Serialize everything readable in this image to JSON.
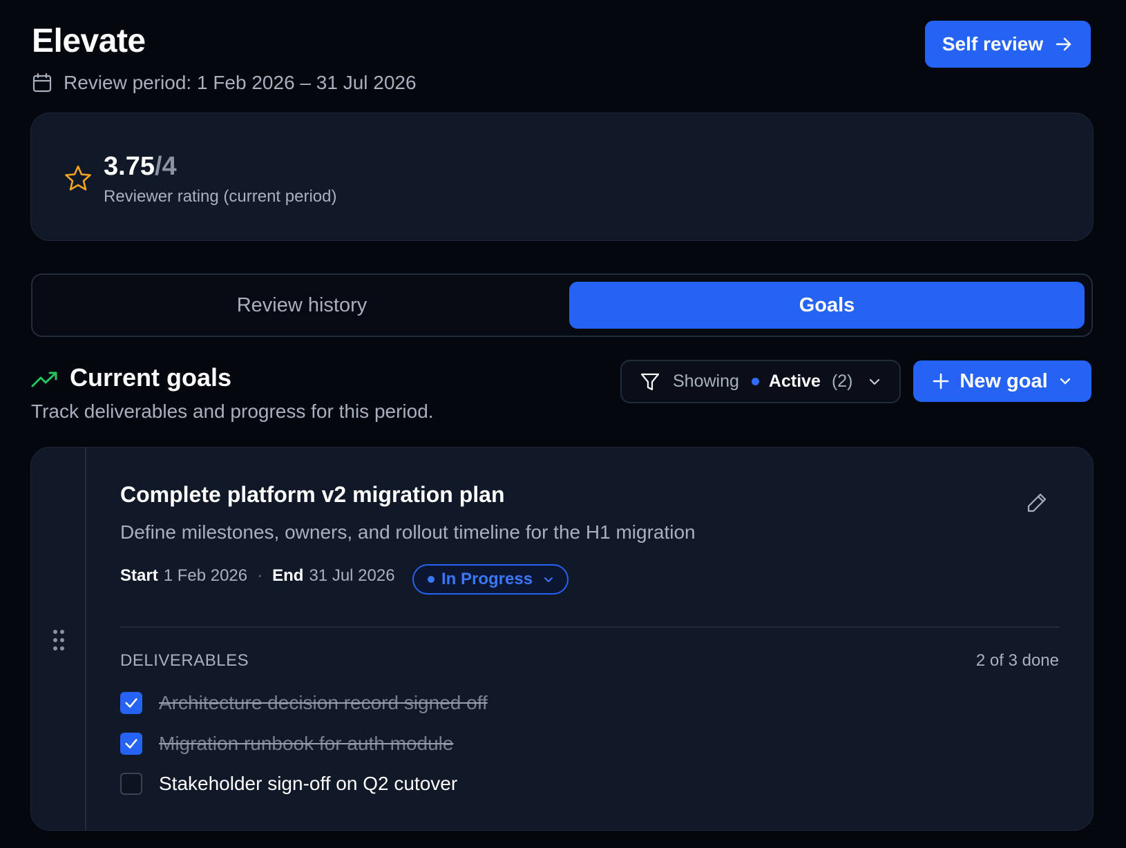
{
  "header": {
    "app_title": "Elevate",
    "review_period": "Review period: 1 Feb 2026 – 31 Jul 2026",
    "self_review_label": "Self review"
  },
  "rating": {
    "value": "3.75",
    "max": "/4",
    "label": "Reviewer rating (current period)"
  },
  "tabs": [
    {
      "label": "Review history",
      "active": false
    },
    {
      "label": "Goals",
      "active": true
    }
  ],
  "goals_section": {
    "title": "Current goals",
    "subtitle": "Track deliverables and progress for this period.",
    "filter": {
      "showing_label": "Showing",
      "value": "Active",
      "count": "(2)"
    },
    "new_goal_label": "New goal"
  },
  "goal": {
    "title": "Complete platform v2 migration plan",
    "description": "Define milestones, owners, and rollout timeline for the H1 migration",
    "start_label": "Start",
    "start_date": "1 Feb 2026",
    "separator": "·",
    "end_label": "End",
    "end_date": "31 Jul 2026",
    "status": "In Progress",
    "deliverables_heading": "DELIVERABLES",
    "deliverables_count": "2 of 3 done",
    "deliverables": [
      {
        "label": "Architecture decision record signed off",
        "done": true
      },
      {
        "label": "Migration runbook for auth module",
        "done": true
      },
      {
        "label": "Stakeholder sign-off on Q2 cutover",
        "done": false
      }
    ]
  },
  "colors": {
    "background": "#05070f",
    "card": "#111827",
    "accent": "#2563f5",
    "star": "#f5a524",
    "trend": "#22c55e"
  },
  "icons": {
    "period": "calendar-icon",
    "self_review": "arrow-right-icon",
    "rating": "star-icon",
    "goals": "trending-up-icon",
    "filter": "filter-icon",
    "new_goal": "plus-icon",
    "edit": "pencil-icon",
    "drag": "drag-handle-icon"
  }
}
